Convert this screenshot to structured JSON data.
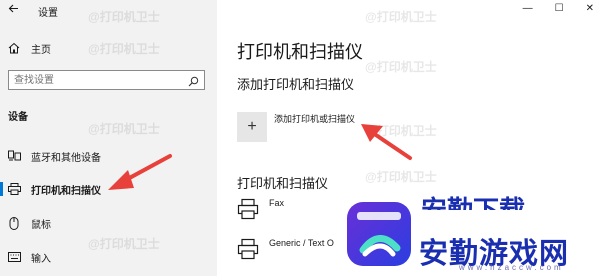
{
  "window": {
    "title": "设置",
    "controls": {
      "minimize": "—",
      "maximize": "☐",
      "close": "✕"
    }
  },
  "sidebar": {
    "home_label": "主页",
    "search_placeholder": "查找设置",
    "section_header": "设备",
    "items": [
      {
        "label": "蓝牙和其他设备",
        "icon": "bluetooth-devices-icon"
      },
      {
        "label": "打印机和扫描仪",
        "icon": "printer-icon",
        "active": true
      },
      {
        "label": "鼠标",
        "icon": "mouse-icon"
      },
      {
        "label": "输入",
        "icon": "keyboard-icon"
      }
    ]
  },
  "main": {
    "title": "打印机和扫描仪",
    "add_section_header": "添加打印机和扫描仪",
    "add_button_symbol": "+",
    "add_button_label": "添加打印机或扫描仪",
    "printers_section_header": "打印机和扫描仪",
    "printers": [
      {
        "name": "Fax"
      },
      {
        "name": "Generic / Text O"
      }
    ]
  },
  "watermark": {
    "text": "@打印机卫士"
  },
  "overlay_logo": {
    "title": "安勤游戏网",
    "title_partial": "安勤下载",
    "url": "www.hzaccw.com"
  },
  "colors": {
    "accent": "#0078d4",
    "sidebar_bg": "#f2f2f2",
    "arrow_red": "#e8403a",
    "logo_blue": "#1a2fb0"
  }
}
